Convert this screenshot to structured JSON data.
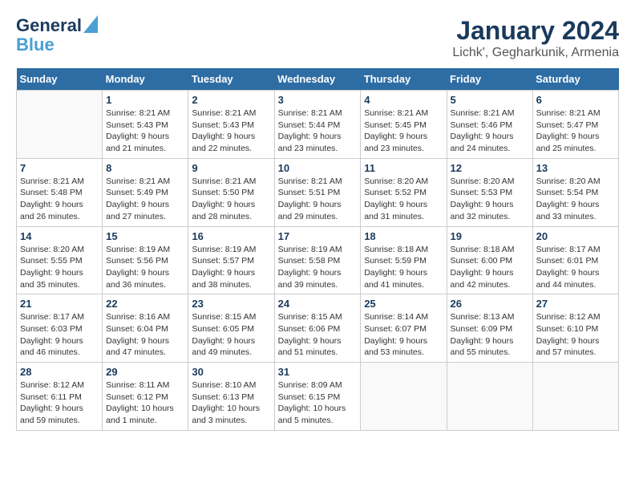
{
  "logo": {
    "line1": "General",
    "line2": "Blue"
  },
  "title": "January 2024",
  "location": "Lichk', Gegharkunik, Armenia",
  "days_of_week": [
    "Sunday",
    "Monday",
    "Tuesday",
    "Wednesday",
    "Thursday",
    "Friday",
    "Saturday"
  ],
  "weeks": [
    [
      {
        "day": "",
        "info": ""
      },
      {
        "day": "1",
        "info": "Sunrise: 8:21 AM\nSunset: 5:43 PM\nDaylight: 9 hours\nand 21 minutes."
      },
      {
        "day": "2",
        "info": "Sunrise: 8:21 AM\nSunset: 5:43 PM\nDaylight: 9 hours\nand 22 minutes."
      },
      {
        "day": "3",
        "info": "Sunrise: 8:21 AM\nSunset: 5:44 PM\nDaylight: 9 hours\nand 23 minutes."
      },
      {
        "day": "4",
        "info": "Sunrise: 8:21 AM\nSunset: 5:45 PM\nDaylight: 9 hours\nand 23 minutes."
      },
      {
        "day": "5",
        "info": "Sunrise: 8:21 AM\nSunset: 5:46 PM\nDaylight: 9 hours\nand 24 minutes."
      },
      {
        "day": "6",
        "info": "Sunrise: 8:21 AM\nSunset: 5:47 PM\nDaylight: 9 hours\nand 25 minutes."
      }
    ],
    [
      {
        "day": "7",
        "info": "Sunrise: 8:21 AM\nSunset: 5:48 PM\nDaylight: 9 hours\nand 26 minutes."
      },
      {
        "day": "8",
        "info": "Sunrise: 8:21 AM\nSunset: 5:49 PM\nDaylight: 9 hours\nand 27 minutes."
      },
      {
        "day": "9",
        "info": "Sunrise: 8:21 AM\nSunset: 5:50 PM\nDaylight: 9 hours\nand 28 minutes."
      },
      {
        "day": "10",
        "info": "Sunrise: 8:21 AM\nSunset: 5:51 PM\nDaylight: 9 hours\nand 29 minutes."
      },
      {
        "day": "11",
        "info": "Sunrise: 8:20 AM\nSunset: 5:52 PM\nDaylight: 9 hours\nand 31 minutes."
      },
      {
        "day": "12",
        "info": "Sunrise: 8:20 AM\nSunset: 5:53 PM\nDaylight: 9 hours\nand 32 minutes."
      },
      {
        "day": "13",
        "info": "Sunrise: 8:20 AM\nSunset: 5:54 PM\nDaylight: 9 hours\nand 33 minutes."
      }
    ],
    [
      {
        "day": "14",
        "info": "Sunrise: 8:20 AM\nSunset: 5:55 PM\nDaylight: 9 hours\nand 35 minutes."
      },
      {
        "day": "15",
        "info": "Sunrise: 8:19 AM\nSunset: 5:56 PM\nDaylight: 9 hours\nand 36 minutes."
      },
      {
        "day": "16",
        "info": "Sunrise: 8:19 AM\nSunset: 5:57 PM\nDaylight: 9 hours\nand 38 minutes."
      },
      {
        "day": "17",
        "info": "Sunrise: 8:19 AM\nSunset: 5:58 PM\nDaylight: 9 hours\nand 39 minutes."
      },
      {
        "day": "18",
        "info": "Sunrise: 8:18 AM\nSunset: 5:59 PM\nDaylight: 9 hours\nand 41 minutes."
      },
      {
        "day": "19",
        "info": "Sunrise: 8:18 AM\nSunset: 6:00 PM\nDaylight: 9 hours\nand 42 minutes."
      },
      {
        "day": "20",
        "info": "Sunrise: 8:17 AM\nSunset: 6:01 PM\nDaylight: 9 hours\nand 44 minutes."
      }
    ],
    [
      {
        "day": "21",
        "info": "Sunrise: 8:17 AM\nSunset: 6:03 PM\nDaylight: 9 hours\nand 46 minutes."
      },
      {
        "day": "22",
        "info": "Sunrise: 8:16 AM\nSunset: 6:04 PM\nDaylight: 9 hours\nand 47 minutes."
      },
      {
        "day": "23",
        "info": "Sunrise: 8:15 AM\nSunset: 6:05 PM\nDaylight: 9 hours\nand 49 minutes."
      },
      {
        "day": "24",
        "info": "Sunrise: 8:15 AM\nSunset: 6:06 PM\nDaylight: 9 hours\nand 51 minutes."
      },
      {
        "day": "25",
        "info": "Sunrise: 8:14 AM\nSunset: 6:07 PM\nDaylight: 9 hours\nand 53 minutes."
      },
      {
        "day": "26",
        "info": "Sunrise: 8:13 AM\nSunset: 6:09 PM\nDaylight: 9 hours\nand 55 minutes."
      },
      {
        "day": "27",
        "info": "Sunrise: 8:12 AM\nSunset: 6:10 PM\nDaylight: 9 hours\nand 57 minutes."
      }
    ],
    [
      {
        "day": "28",
        "info": "Sunrise: 8:12 AM\nSunset: 6:11 PM\nDaylight: 9 hours\nand 59 minutes."
      },
      {
        "day": "29",
        "info": "Sunrise: 8:11 AM\nSunset: 6:12 PM\nDaylight: 10 hours\nand 1 minute."
      },
      {
        "day": "30",
        "info": "Sunrise: 8:10 AM\nSunset: 6:13 PM\nDaylight: 10 hours\nand 3 minutes."
      },
      {
        "day": "31",
        "info": "Sunrise: 8:09 AM\nSunset: 6:15 PM\nDaylight: 10 hours\nand 5 minutes."
      },
      {
        "day": "",
        "info": ""
      },
      {
        "day": "",
        "info": ""
      },
      {
        "day": "",
        "info": ""
      }
    ]
  ]
}
